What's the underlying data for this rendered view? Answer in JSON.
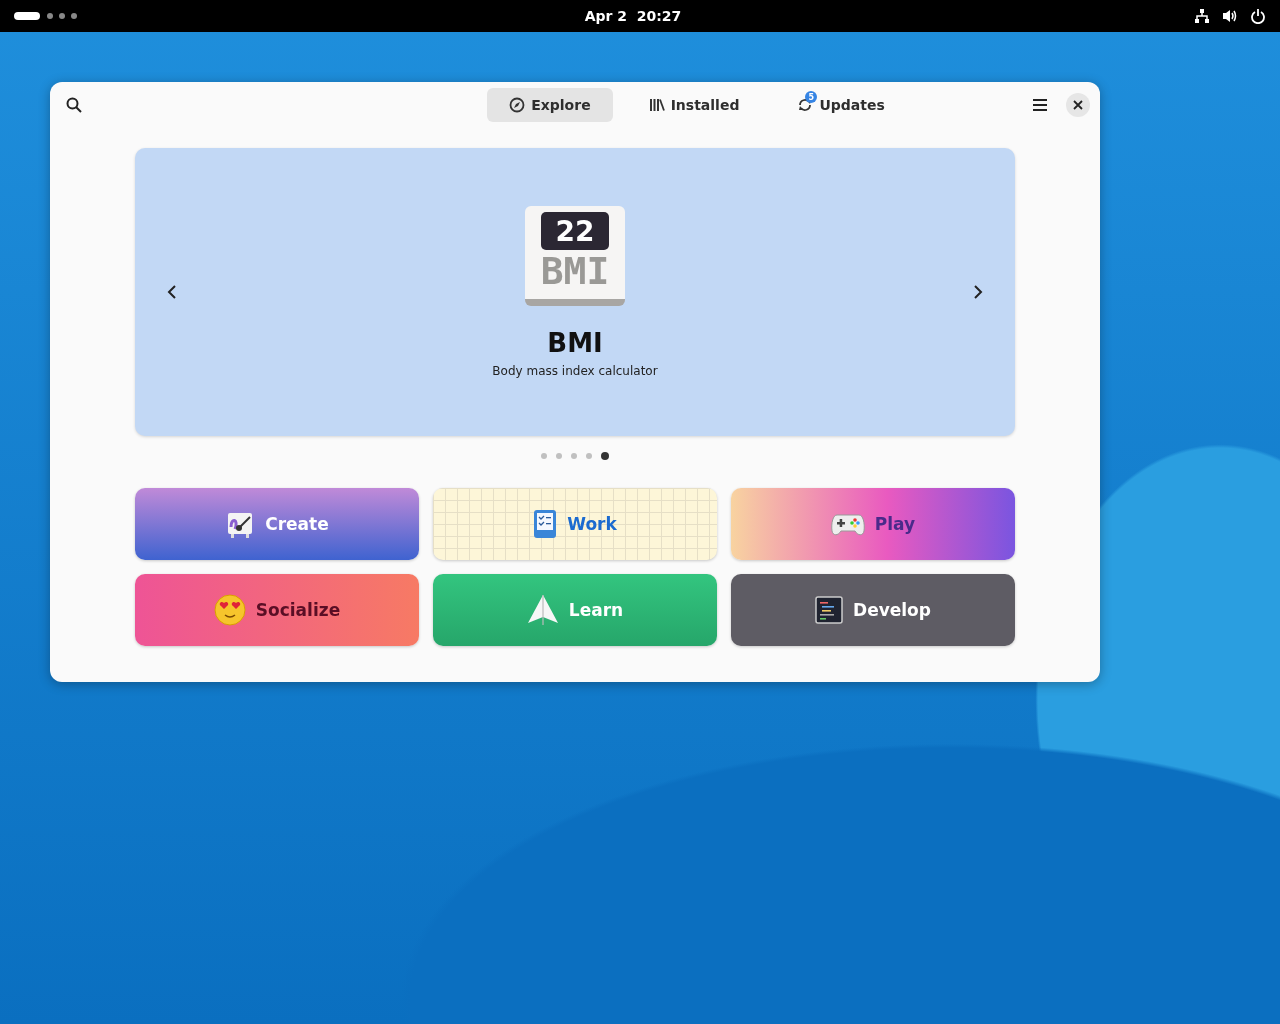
{
  "top_bar": {
    "clock": "Apr 2  20:27"
  },
  "header": {
    "tabs": [
      {
        "label": "Explore",
        "kind": "explore",
        "selected": true
      },
      {
        "label": "Installed",
        "kind": "installed",
        "selected": false
      },
      {
        "label": "Updates",
        "kind": "updates",
        "selected": false,
        "badge": "5"
      }
    ]
  },
  "carousel": {
    "app": {
      "icon_number": "22",
      "icon_label": "BMI",
      "name": "BMI",
      "summary": "Body mass index calculator"
    },
    "pages": [
      {
        "selected": false
      },
      {
        "selected": false
      },
      {
        "selected": false
      },
      {
        "selected": false
      },
      {
        "selected": true
      }
    ]
  },
  "categories": [
    {
      "label": "Create",
      "kind": "create"
    },
    {
      "label": "Work",
      "kind": "work"
    },
    {
      "label": "Play",
      "kind": "play"
    },
    {
      "label": "Socialize",
      "kind": "socialize"
    },
    {
      "label": "Learn",
      "kind": "learn"
    },
    {
      "label": "Develop",
      "kind": "develop"
    }
  ]
}
